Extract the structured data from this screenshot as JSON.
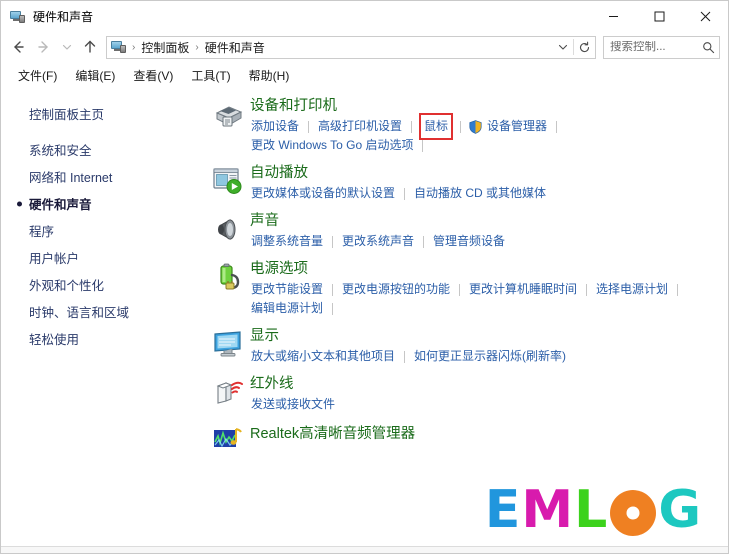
{
  "window": {
    "title": "硬件和声音",
    "title_icon": "hardware-sound-icon",
    "minimize": "—",
    "maximize": "□",
    "close": "✕"
  },
  "nav": {
    "back": "back-arrow",
    "forward": "forward-arrow",
    "recent": "chevron-down",
    "up": "up-arrow",
    "refresh": "refresh-icon",
    "dropdown": "chevron-down"
  },
  "breadcrumb": {
    "icon": "control-panel-icon",
    "items": [
      "控制面板",
      "硬件和声音"
    ],
    "separator": "›"
  },
  "search": {
    "placeholder": "搜索控制...",
    "value": "",
    "icon": "search-icon"
  },
  "menubar": {
    "items": [
      "文件(F)",
      "编辑(E)",
      "查看(V)",
      "工具(T)",
      "帮助(H)"
    ]
  },
  "sidebar": {
    "home": "控制面板主页",
    "items": [
      {
        "label": "系统和安全",
        "current": false
      },
      {
        "label": "网络和 Internet",
        "current": false
      },
      {
        "label": "硬件和声音",
        "current": true
      },
      {
        "label": "程序",
        "current": false
      },
      {
        "label": "用户帐户",
        "current": false
      },
      {
        "label": "外观和个性化",
        "current": false
      },
      {
        "label": "时钟、语言和区域",
        "current": false
      },
      {
        "label": "轻松使用",
        "current": false
      }
    ]
  },
  "categories": [
    {
      "icon": "devices-printers-icon",
      "title": "设备和打印机",
      "links": [
        {
          "label": "添加设备"
        },
        {
          "label": "高级打印机设置"
        },
        {
          "label": "鼠标",
          "highlighted": true
        },
        {
          "label": "设备管理器",
          "shield": true
        },
        {
          "label": "更改 Windows To Go 启动选项",
          "trailing_separator_before": true
        }
      ]
    },
    {
      "icon": "autoplay-icon",
      "title": "自动播放",
      "links": [
        {
          "label": "更改媒体或设备的默认设置"
        },
        {
          "label": "自动播放 CD 或其他媒体"
        }
      ]
    },
    {
      "icon": "sound-icon",
      "title": "声音",
      "links": [
        {
          "label": "调整系统音量"
        },
        {
          "label": "更改系统声音"
        },
        {
          "label": "管理音频设备"
        }
      ]
    },
    {
      "icon": "power-options-icon",
      "title": "电源选项",
      "links": [
        {
          "label": "更改节能设置"
        },
        {
          "label": "更改电源按钮的功能"
        },
        {
          "label": "更改计算机睡眠时间"
        },
        {
          "label": "选择电源计划"
        },
        {
          "label": "编辑电源计划"
        }
      ]
    },
    {
      "icon": "display-icon",
      "title": "显示",
      "links": [
        {
          "label": "放大或缩小文本和其他项目"
        },
        {
          "label": "如何更正显示器闪烁(刷新率)"
        }
      ]
    },
    {
      "icon": "infrared-icon",
      "title": "红外线",
      "links": [
        {
          "label": "发送或接收文件"
        }
      ]
    },
    {
      "icon": "realtek-audio-icon",
      "title": "Realtek高清晰音频管理器",
      "links": []
    }
  ],
  "logo": {
    "letters": [
      {
        "char": "E",
        "color": "#2196dd"
      },
      {
        "char": "M",
        "color": "#d81bad"
      },
      {
        "char": "L",
        "color": "#3cd21c"
      },
      {
        "char": "O",
        "color": "#ef8022"
      },
      {
        "char": "G",
        "color": "#1dc8c0"
      }
    ]
  },
  "colors": {
    "heading_green": "#1a6b1a",
    "link_blue": "#2b5ea8",
    "sidebar_text": "#2a3a6a",
    "highlight_red": "#e03030"
  }
}
